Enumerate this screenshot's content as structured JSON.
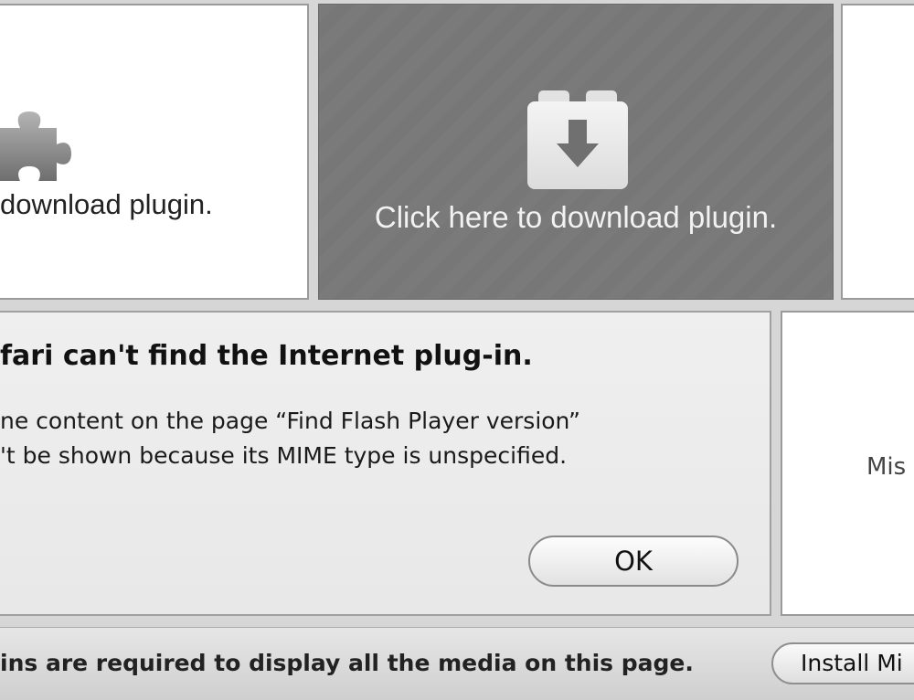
{
  "panel_plugin_light": {
    "label": "download plugin.",
    "icon": "puzzle-piece-icon"
  },
  "panel_plugin_dark": {
    "label": "Click here to download plugin.",
    "icon": "download-brick-icon"
  },
  "alert": {
    "title": "fari can't find the Internet plug-in.",
    "message_line1": "ne content on the page “Find Flash Player version”",
    "message_line2": "'t be shown because its MIME type is unspecified.",
    "ok_label": "OK"
  },
  "panel_missing": {
    "label": "Mis"
  },
  "notification_bar": {
    "message": "ins are required to display all the media on this page.",
    "install_label": "Install Mi"
  },
  "colors": {
    "dark_panel": "#7a7a7a",
    "dialog_bg": "#ececec",
    "page_bg": "#d6d6d6"
  }
}
